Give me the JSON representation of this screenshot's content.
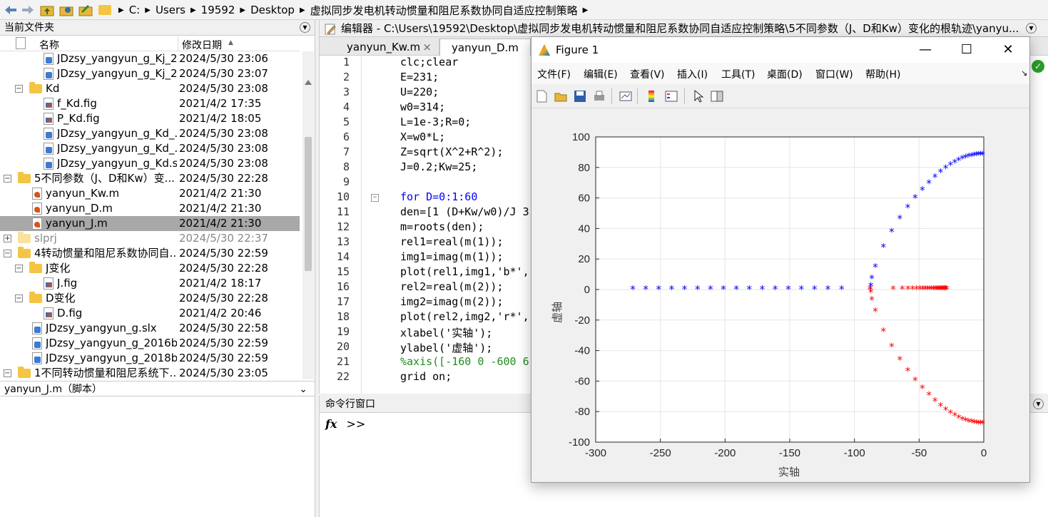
{
  "path": {
    "segments": [
      "C:",
      "Users",
      "19592",
      "Desktop",
      "虚拟同步发电机转动惯量和阻尼系数协同自适应控制策略"
    ]
  },
  "file_browser": {
    "title": "当前文件夹",
    "col_name": "名称",
    "col_date": "修改日期",
    "rows": [
      {
        "name": "JDzsy_yangyun_g_Kj_2...",
        "date": "2024/5/30 23:06"
      },
      {
        "name": "JDzsy_yangyun_g_Kj_2...",
        "date": "2024/5/30 23:07"
      },
      {
        "name": "Kd",
        "date": "2024/5/30 23:08"
      },
      {
        "name": "f_Kd.fig",
        "date": "2021/4/2 17:35"
      },
      {
        "name": "P_Kd.fig",
        "date": "2021/4/2 18:05"
      },
      {
        "name": "JDzsy_yangyun_g_Kd_...",
        "date": "2024/5/30 23:08"
      },
      {
        "name": "JDzsy_yangyun_g_Kd_...",
        "date": "2024/5/30 23:08"
      },
      {
        "name": "JDzsy_yangyun_g_Kd.slx",
        "date": "2024/5/30 23:08"
      },
      {
        "name": "5不同参数（J、D和Kw）变...",
        "date": "2024/5/30 22:28"
      },
      {
        "name": "yanyun_Kw.m",
        "date": "2021/4/2 21:30"
      },
      {
        "name": "yanyun_D.m",
        "date": "2021/4/2 21:30"
      },
      {
        "name": "yanyun_J.m",
        "date": "2021/4/2 21:30"
      },
      {
        "name": "slprj",
        "date": "2024/5/30 22:37"
      },
      {
        "name": "4转动惯量和阻尼系数协同自...",
        "date": "2024/5/30 22:59"
      },
      {
        "name": "J变化",
        "date": "2024/5/30 22:28"
      },
      {
        "name": "J.fig",
        "date": "2021/4/2 18:17"
      },
      {
        "name": "D变化",
        "date": "2024/5/30 22:28"
      },
      {
        "name": "D.fig",
        "date": "2021/4/2 20:46"
      },
      {
        "name": "JDzsy_yangyun_g.slx",
        "date": "2024/5/30 22:58"
      },
      {
        "name": "JDzsy_yangyun_g_2016b...",
        "date": "2024/5/30 22:59"
      },
      {
        "name": "JDzsy_yangyun_g_2018b...",
        "date": "2024/5/30 22:59"
      },
      {
        "name": "1不同转动惯量和阻尼系统下...",
        "date": "2024/5/30 23:05"
      }
    ],
    "details": "yanyun_J.m（脚本）"
  },
  "editor": {
    "title": "编辑器 - C:\\Users\\19592\\Desktop\\虚拟同步发电机转动惯量和阻尼系数协同自适应控制策略\\5不同参数（J、D和Kw）变化的根轨迹\\yanyu...",
    "tabs": [
      "yanyun_Kw.m",
      "yanyun_D.m"
    ],
    "lines": [
      {
        "n": "1",
        "t": "clc;clear"
      },
      {
        "n": "2",
        "t": "E=231;"
      },
      {
        "n": "3",
        "t": "U=220;"
      },
      {
        "n": "4",
        "t": "w0=314;"
      },
      {
        "n": "5",
        "t": "L=1e-3;R=0;"
      },
      {
        "n": "6",
        "t": "X=w0*L;"
      },
      {
        "n": "7",
        "t": "Z=sqrt(X^2+R^2);"
      },
      {
        "n": "8",
        "t": "J=0.2;Kw=25;"
      },
      {
        "n": "9",
        "t": ""
      },
      {
        "n": "10",
        "t": "for D=0:1:60"
      },
      {
        "n": "11",
        "t": "den=[1 (D+Kw/w0)/J 3"
      },
      {
        "n": "12",
        "t": "m=roots(den);"
      },
      {
        "n": "13",
        "t": "rel1=real(m(1));"
      },
      {
        "n": "14",
        "t": "img1=imag(m(1));"
      },
      {
        "n": "15",
        "t": "plot(rel1,img1,'b*',"
      },
      {
        "n": "16",
        "t": "rel2=real(m(2));"
      },
      {
        "n": "17",
        "t": "img2=imag(m(2));"
      },
      {
        "n": "18",
        "t": "plot(rel2,img2,'r*',"
      },
      {
        "n": "19",
        "t": "xlabel('实轴');"
      },
      {
        "n": "20",
        "t": "ylabel('虚轴');"
      },
      {
        "n": "21",
        "t": "%axis([-160 0 -600 6"
      },
      {
        "n": "22",
        "t": "grid on;"
      }
    ]
  },
  "command_window": {
    "title": "命令行窗口",
    "fx": "fx",
    "prompt": ">>"
  },
  "figure": {
    "title": "Figure 1",
    "menus": [
      "文件(F)",
      "编辑(E)",
      "查看(V)",
      "插入(I)",
      "工具(T)",
      "桌面(D)",
      "窗口(W)",
      "帮助(H)"
    ]
  },
  "chart_data": {
    "type": "scatter",
    "xlabel": "实轴",
    "ylabel": "虚轴",
    "xlim": [
      -300,
      0
    ],
    "ylim": [
      -100,
      100
    ],
    "xticks": [
      -300,
      -250,
      -200,
      -150,
      -100,
      -50,
      0
    ],
    "yticks": [
      -100,
      -80,
      -60,
      -40,
      -20,
      0,
      20,
      40,
      60,
      80,
      100
    ],
    "grid": true,
    "series": [
      {
        "color": "#0000ff",
        "marker": "*",
        "x": [
          -1.0,
          -2.4,
          -3.9,
          -5.6,
          -7.4,
          -9.4,
          -11.6,
          -14.0,
          -16.6,
          -19.4,
          -22.4,
          -25.8,
          -29.4,
          -33.4,
          -37.7,
          -42.4,
          -47.5,
          -53.0,
          -58.8,
          -64.9,
          -71.2,
          -77.6,
          -83.8,
          -86.6,
          -87.3,
          -87.8,
          -109.9,
          -120.5,
          -130.8,
          -141.0,
          -151.1,
          -161.2,
          -171.3,
          -181.3,
          -191.3,
          -201.3,
          -211.3,
          -221.3,
          -231.3,
          -241.3,
          -251.3,
          -261.3,
          -271.3
        ],
        "y": [
          88,
          88,
          88,
          87.8,
          87.6,
          87.2,
          86.8,
          86.2,
          85.4,
          84.4,
          83,
          81.3,
          79.2,
          76.6,
          73.4,
          69.5,
          65,
          59.7,
          53.5,
          46.3,
          37.7,
          27.6,
          14.5,
          7,
          2,
          0,
          0,
          0,
          0,
          0,
          0,
          0,
          0,
          0,
          0,
          0,
          0,
          0,
          0,
          0,
          0,
          0,
          0
        ]
      },
      {
        "color": "#ff0000",
        "marker": "*",
        "x": [
          -1.0,
          -2.4,
          -3.9,
          -5.6,
          -7.4,
          -9.4,
          -11.6,
          -14.0,
          -16.6,
          -19.4,
          -22.4,
          -25.8,
          -29.4,
          -33.4,
          -37.7,
          -42.4,
          -47.5,
          -53.0,
          -58.8,
          -64.9,
          -71.2,
          -77.6,
          -83.8,
          -86.6,
          -87.3,
          -87.8,
          -70.0,
          -63.0,
          -58.5,
          -55.0,
          -52.0,
          -49.5,
          -47.3,
          -45.3,
          -43.5,
          -41.9,
          -40.4,
          -39.0,
          -37.7,
          -36.5,
          -35.4,
          -34.4,
          -33.4,
          -32.5,
          -31.7,
          -30.9,
          -30.2,
          -29.5,
          -28.8
        ],
        "y": [
          -88,
          -88,
          -88,
          -87.8,
          -87.6,
          -87.2,
          -86.8,
          -86.2,
          -85.4,
          -84.4,
          -83,
          -81.3,
          -79.2,
          -76.6,
          -73.4,
          -69.5,
          -65,
          -59.7,
          -53.5,
          -46.3,
          -37.7,
          -27.6,
          -14.5,
          -7,
          -2,
          0,
          0,
          0,
          0,
          0,
          0,
          0,
          0,
          0,
          0,
          0,
          0,
          0,
          0,
          0,
          0,
          0,
          0,
          0,
          0,
          0,
          0,
          0,
          0
        ]
      }
    ]
  }
}
